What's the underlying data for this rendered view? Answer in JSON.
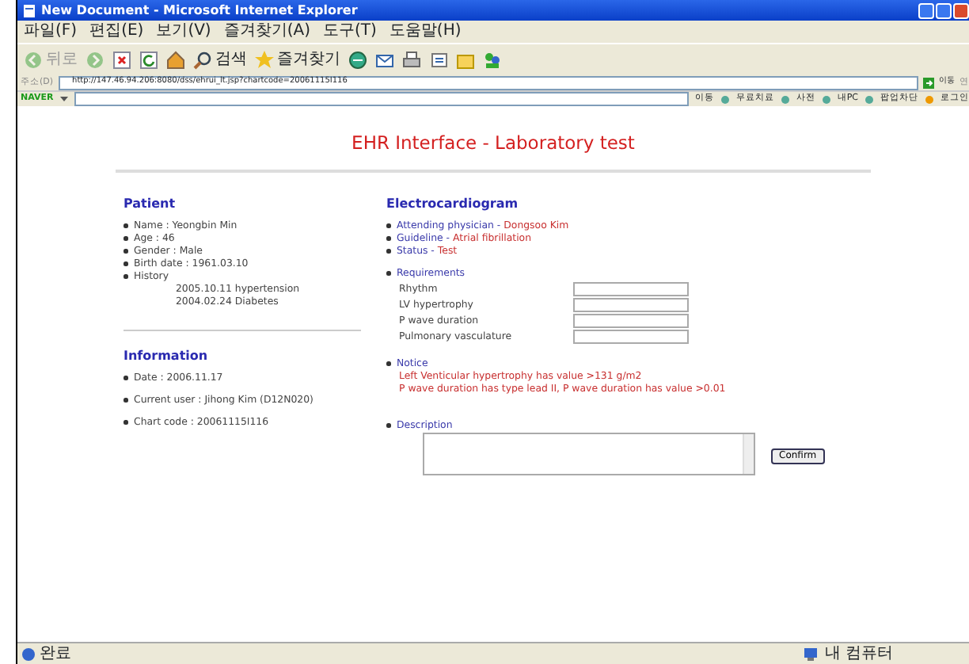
{
  "window": {
    "title": "New Document - Microsoft Internet Explorer"
  },
  "menu": [
    "파일(F)",
    "편집(E)",
    "보기(V)",
    "즐겨찾기(A)",
    "도구(T)",
    "도움말(H)"
  ],
  "toolbar": [
    {
      "kind": "back",
      "label": "뒤로",
      "disabled": true
    },
    {
      "kind": "forward",
      "disabled": true
    },
    {
      "kind": "stop",
      "disabled": false
    },
    {
      "kind": "refresh",
      "disabled": false
    },
    {
      "kind": "home",
      "disabled": false
    },
    {
      "kind": "search",
      "label": "검색",
      "disabled": false
    },
    {
      "kind": "favorites",
      "label": "즐겨찾기",
      "disabled": false
    },
    {
      "kind": "media",
      "disabled": false
    },
    {
      "kind": "mail",
      "disabled": false
    },
    {
      "kind": "print",
      "disabled": false
    },
    {
      "kind": "edit",
      "disabled": false
    },
    {
      "kind": "folder",
      "disabled": false
    },
    {
      "kind": "messenger",
      "disabled": false
    }
  ],
  "address": {
    "label": "주소(D)",
    "url": "http://147.46.94.206:8080/dss/ehrui_lt.jsp?chartcode=20061115I116",
    "go": "이동",
    "extra": "연"
  },
  "naver_bar": {
    "brand": "NAVER",
    "go": "이동",
    "links": [
      "무료치료",
      "사전",
      "내PC",
      "팝업차단"
    ],
    "login": "로그인"
  },
  "page": {
    "title": "EHR Interface - Laboratory test",
    "patient": {
      "heading": "Patient",
      "items": [
        "Name : Yeongbin Min",
        "Age : 46",
        "Gender : Male",
        "Birth date : 1961.03.10",
        "History"
      ],
      "history": [
        "2005.10.11 hypertension",
        "2004.02.24 Diabetes"
      ]
    },
    "information": {
      "heading": "Information",
      "items": [
        "Date : 2006.11.17",
        "Current user : Jihong Kim (D12N020)",
        "Chart code : 20061115I116"
      ]
    },
    "ecg": {
      "heading": "Electrocardiogram",
      "info": [
        {
          "label": "Attending physician -",
          "value": "Dongsoo Kim"
        },
        {
          "label": "Guideline -",
          "value": "Atrial fibrillation"
        },
        {
          "label": "Status -",
          "value": "Test"
        }
      ],
      "requirements": {
        "label": "Requirements",
        "fields": [
          "Rhythm",
          "LV hypertrophy",
          "P wave duration",
          "Pulmonary vasculature"
        ]
      },
      "notice": {
        "label": "Notice",
        "lines": [
          "Left Venticular hypertrophy has value >131 g/m2",
          "P wave duration has type lead II, P wave duration has value >0.01"
        ]
      },
      "description": {
        "label": "Description"
      },
      "confirm": "Confirm"
    }
  },
  "status_bar": {
    "left": "완료",
    "right": "내 컴퓨터"
  }
}
